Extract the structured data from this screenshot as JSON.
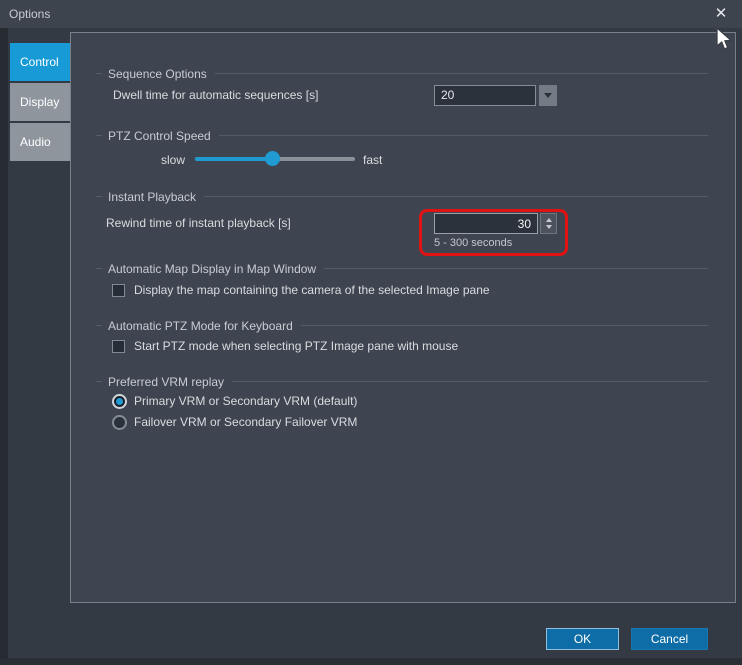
{
  "titlebar": {
    "title": "Options",
    "close": "✕"
  },
  "tabs": {
    "control": "Control",
    "display": "Display",
    "audio": "Audio",
    "active": "Control"
  },
  "sequence": {
    "header": "Sequence Options",
    "dwell_label": "Dwell time for automatic sequences [s]",
    "dwell_value": "20"
  },
  "ptz_speed": {
    "header": "PTZ Control Speed",
    "slow": "slow",
    "fast": "fast",
    "thumb_position": "center"
  },
  "instant_playback": {
    "header": "Instant Playback",
    "rewind_label": "Rewind time of instant playback [s]",
    "rewind_value": "30",
    "range_hint": "5 - 300 seconds"
  },
  "map_display": {
    "header": "Automatic Map Display in Map Window",
    "checkbox_label": "Display the map containing the camera of the selected Image pane",
    "checked": false
  },
  "ptz_keyboard": {
    "header": "Automatic PTZ Mode for Keyboard",
    "checkbox_label": "Start PTZ mode when selecting PTZ Image pane with mouse",
    "checked": false
  },
  "vrm_replay": {
    "header": "Preferred VRM replay",
    "primary_label": "Primary VRM or Secondary VRM (default)",
    "failover_label": "Failover VRM or Secondary Failover VRM",
    "selected": "primary"
  },
  "buttons": {
    "ok": "OK",
    "cancel": "Cancel"
  },
  "colors": {
    "accent_blue": "#189ad6",
    "button_blue": "#0e6da6",
    "highlight_red": "#e01212",
    "panel_bg": "#3f4550",
    "titlebar_bg": "#3e444e"
  }
}
